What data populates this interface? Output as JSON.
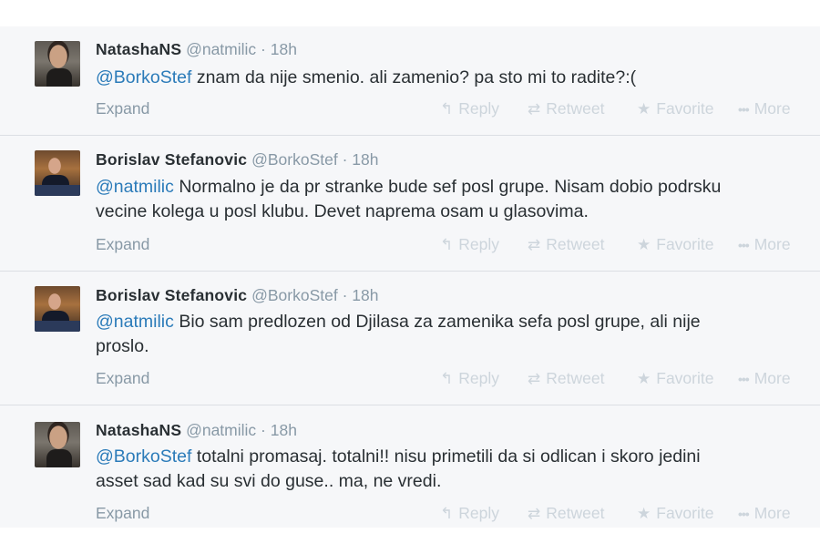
{
  "tweets": [
    {
      "author": "NatashaNS",
      "handle": "@natmilic",
      "time": "18h",
      "avatar": "natasha-avatar",
      "mention": "@BorkoStef",
      "text": " znam da nije smenio. ali zamenio? pa sto mi to radite?:(",
      "text_line2": ""
    },
    {
      "author": "Borislav Stefanovic",
      "handle": "@BorkoStef",
      "time": "18h",
      "avatar": "borislav-avatar",
      "mention": "@natmilic",
      "text": " Normalno je da pr stranke bude sef posl grupe. Nisam dobio podrsku",
      "text_line2": "vecine kolega u posl klubu. Devet naprema osam u glasovima."
    },
    {
      "author": "Borislav Stefanovic",
      "handle": "@BorkoStef",
      "time": "18h",
      "avatar": "borislav-avatar",
      "mention": "@natmilic",
      "text": " Bio sam predlozen od Djilasa za zamenika sefa posl grupe, ali nije",
      "text_line2": "proslo."
    },
    {
      "author": "NatashaNS",
      "handle": "@natmilic",
      "time": "18h",
      "avatar": "natasha-avatar",
      "mention": "@BorkoStef",
      "text": " totalni promasaj. totalni!! nisu primetili da si odlican i skoro jedini",
      "text_line2": "asset sad kad su svi do guse.. ma, ne vredi."
    }
  ],
  "labels": {
    "separator": "·",
    "expand": "Expand",
    "reply": "Reply",
    "retweet": "Retweet",
    "favorite": "Favorite",
    "more": "More"
  },
  "icons": {
    "reply": "reply-arrow-icon",
    "retweet": "retweet-arrows-icon",
    "favorite": "star-icon",
    "more": "three-dots-icon"
  },
  "colors": {
    "feed_background": "#f6f7f9",
    "mention": "#2b7bb9",
    "name": "#292f33",
    "meta": "#8899a6",
    "action_inactive": "#cdd5dc",
    "divider": "#dcdfe4"
  }
}
